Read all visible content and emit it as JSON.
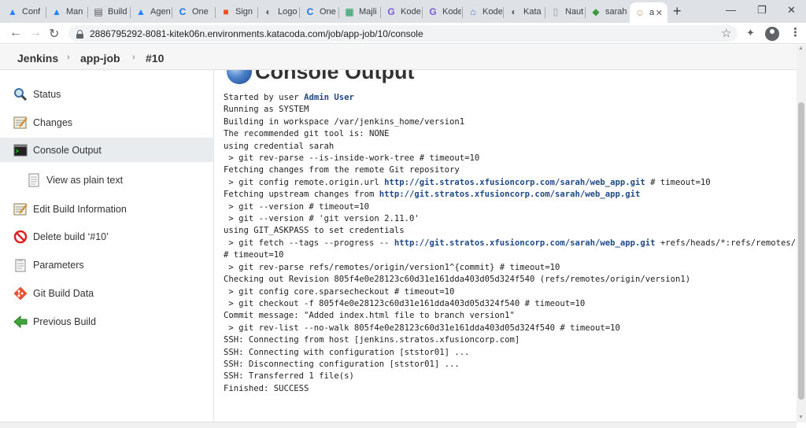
{
  "browser": {
    "tabs": [
      {
        "title": "Conf",
        "icon": "atlassian-icon",
        "color": "#2684ff",
        "glyph": "▲"
      },
      {
        "title": "Man",
        "icon": "atlassian-icon",
        "color": "#2684ff",
        "glyph": "▲"
      },
      {
        "title": "Build",
        "icon": "page-icon",
        "color": "#555555",
        "glyph": "▤"
      },
      {
        "title": "Agen",
        "icon": "atlassian-icon",
        "color": "#2684ff",
        "glyph": "▲"
      },
      {
        "title": "One",
        "icon": "c-icon",
        "color": "#1a73e8",
        "glyph": "C"
      },
      {
        "title": "Sign",
        "icon": "microsoft-icon",
        "color": "#f25022",
        "glyph": "■"
      },
      {
        "title": "Logo",
        "icon": "globe-icon",
        "color": "#5f6368",
        "glyph": "◐"
      },
      {
        "title": "One",
        "icon": "c-icon",
        "color": "#1a73e8",
        "glyph": "C"
      },
      {
        "title": "Majli",
        "icon": "sheets-icon",
        "color": "#0f9d58",
        "glyph": "▦"
      },
      {
        "title": "Kode",
        "icon": "kodekloud-icon",
        "color": "#7b5cd6",
        "glyph": "G"
      },
      {
        "title": "Kode",
        "icon": "kodekloud-icon",
        "color": "#7b5cd6",
        "glyph": "G"
      },
      {
        "title": "Kode",
        "icon": "home-icon",
        "color": "#4b7bb8",
        "glyph": "⌂"
      },
      {
        "title": "Kata",
        "icon": "globe-icon",
        "color": "#5f6368",
        "glyph": "◐"
      },
      {
        "title": "Nauti",
        "icon": "doc-icon",
        "color": "#9aa0a6",
        "glyph": "▯"
      },
      {
        "title": "sarah",
        "icon": "cube-icon",
        "color": "#3c9a3c",
        "glyph": "◆"
      },
      {
        "title": "a",
        "icon": "jenkins-icon",
        "color": "#c9a27a",
        "glyph": "☺",
        "active": true
      }
    ],
    "url": "2886795292-8081-kitek06n.environments.katacoda.com/job/app-job/10/console"
  },
  "breadcrumb": {
    "items": [
      "Jenkins",
      "app-job",
      "#10"
    ]
  },
  "sidebar": {
    "items": [
      {
        "label": "Status",
        "icon": "magnifier-icon"
      },
      {
        "label": "Changes",
        "icon": "notepad-icon"
      },
      {
        "label": "Console Output",
        "icon": "terminal-icon",
        "active": true
      },
      {
        "label": "View as plain text",
        "icon": "document-icon",
        "sub": true
      },
      {
        "label": "Edit Build Information",
        "icon": "notepad-icon"
      },
      {
        "label": "Delete build ‘#10’",
        "icon": "no-entry-icon"
      },
      {
        "label": "Parameters",
        "icon": "clipboard-icon"
      },
      {
        "label": "Git Build Data",
        "icon": "git-icon"
      },
      {
        "label": "Previous Build",
        "icon": "green-arrow-left-icon"
      }
    ]
  },
  "main": {
    "title": "Console Output",
    "console_lines": [
      [
        {
          "t": "Started by user "
        },
        {
          "t": "Admin User",
          "link": true
        }
      ],
      [
        {
          "t": "Running as SYSTEM"
        }
      ],
      [
        {
          "t": "Building in workspace /var/jenkins_home/version1"
        }
      ],
      [
        {
          "t": "The recommended git tool is: NONE"
        }
      ],
      [
        {
          "t": "using credential sarah"
        }
      ],
      [
        {
          "t": " > git rev-parse --is-inside-work-tree # timeout=10"
        }
      ],
      [
        {
          "t": "Fetching changes from the remote Git repository"
        }
      ],
      [
        {
          "t": " > git config remote.origin.url "
        },
        {
          "t": "http://git.stratos.xfusioncorp.com/sarah/web_app.git",
          "link": true
        },
        {
          "t": " # timeout=10"
        }
      ],
      [
        {
          "t": "Fetching upstream changes from "
        },
        {
          "t": "http://git.stratos.xfusioncorp.com/sarah/web_app.git",
          "link": true
        }
      ],
      [
        {
          "t": " > git --version # timeout=10"
        }
      ],
      [
        {
          "t": " > git --version # 'git version 2.11.0'"
        }
      ],
      [
        {
          "t": "using GIT_ASKPASS to set credentials"
        }
      ],
      [
        {
          "t": " > git fetch --tags --progress -- "
        },
        {
          "t": "http://git.stratos.xfusioncorp.com/sarah/web_app.git",
          "link": true
        },
        {
          "t": " +refs/heads/*:refs/remotes/origin/*"
        }
      ],
      [
        {
          "t": "# timeout=10"
        }
      ],
      [
        {
          "t": " > git rev-parse refs/remotes/origin/version1^{commit} # timeout=10"
        }
      ],
      [
        {
          "t": "Checking out Revision 805f4e0e28123c60d31e161dda403d05d324f540 (refs/remotes/origin/version1)"
        }
      ],
      [
        {
          "t": " > git config core.sparsecheckout # timeout=10"
        }
      ],
      [
        {
          "t": " > git checkout -f 805f4e0e28123c60d31e161dda403d05d324f540 # timeout=10"
        }
      ],
      [
        {
          "t": "Commit message: \"Added index.html file to branch version1\""
        }
      ],
      [
        {
          "t": " > git rev-list --no-walk 805f4e0e28123c60d31e161dda403d05d324f540 # timeout=10"
        }
      ],
      [
        {
          "t": "SSH: Connecting from host [jenkins.stratos.xfusioncorp.com]"
        }
      ],
      [
        {
          "t": "SSH: Connecting with configuration [ststor01] ..."
        }
      ],
      [
        {
          "t": "SSH: Disconnecting configuration [ststor01] ..."
        }
      ],
      [
        {
          "t": "SSH: Transferred 1 file(s)"
        }
      ],
      [
        {
          "t": "Finished: SUCCESS"
        }
      ]
    ]
  },
  "colors": {
    "link": "#204a87",
    "active_sidebar": "#e9ecef",
    "breadcrumb_bg": "#f6f6f6"
  }
}
